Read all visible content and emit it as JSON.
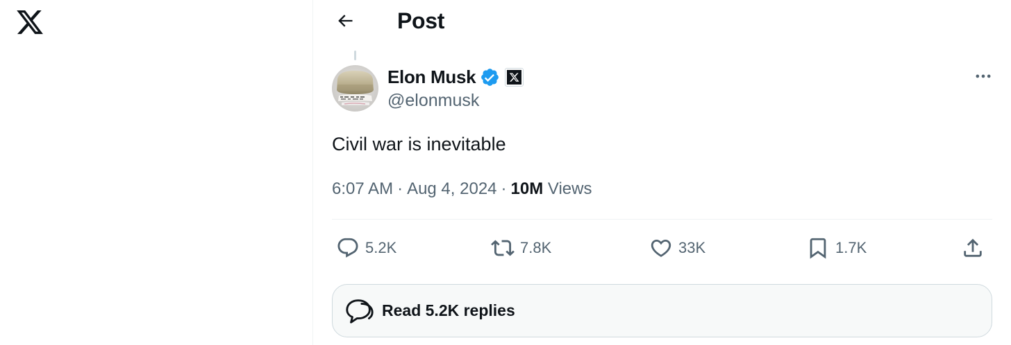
{
  "header": {
    "title": "Post",
    "back_icon": "arrow-left-icon"
  },
  "brand": {
    "logo_icon": "x-logo-icon"
  },
  "post": {
    "author": {
      "display_name": "Elon Musk",
      "handle": "@elonmusk",
      "verified": true,
      "verified_color": "#1d9bf0",
      "affiliate_badge_icon": "x-logo-icon"
    },
    "text": "Civil war is inevitable",
    "time": "6:07 AM",
    "date": "Aug 4, 2024",
    "views_count": "10M",
    "views_label": "Views",
    "meta_separator": "·"
  },
  "actions": {
    "reply": {
      "icon": "reply-icon",
      "count": "5.2K"
    },
    "repost": {
      "icon": "repost-icon",
      "count": "7.8K"
    },
    "like": {
      "icon": "heart-icon",
      "count": "33K"
    },
    "bookmark": {
      "icon": "bookmark-icon",
      "count": "1.7K"
    },
    "share": {
      "icon": "share-icon"
    }
  },
  "read_replies": {
    "label": "Read 5.2K replies",
    "icon": "replies-bubble-icon"
  },
  "colors": {
    "text_primary": "#0f1419",
    "text_secondary": "#536471",
    "border": "#cfd9de",
    "divider": "#eff3f4"
  }
}
